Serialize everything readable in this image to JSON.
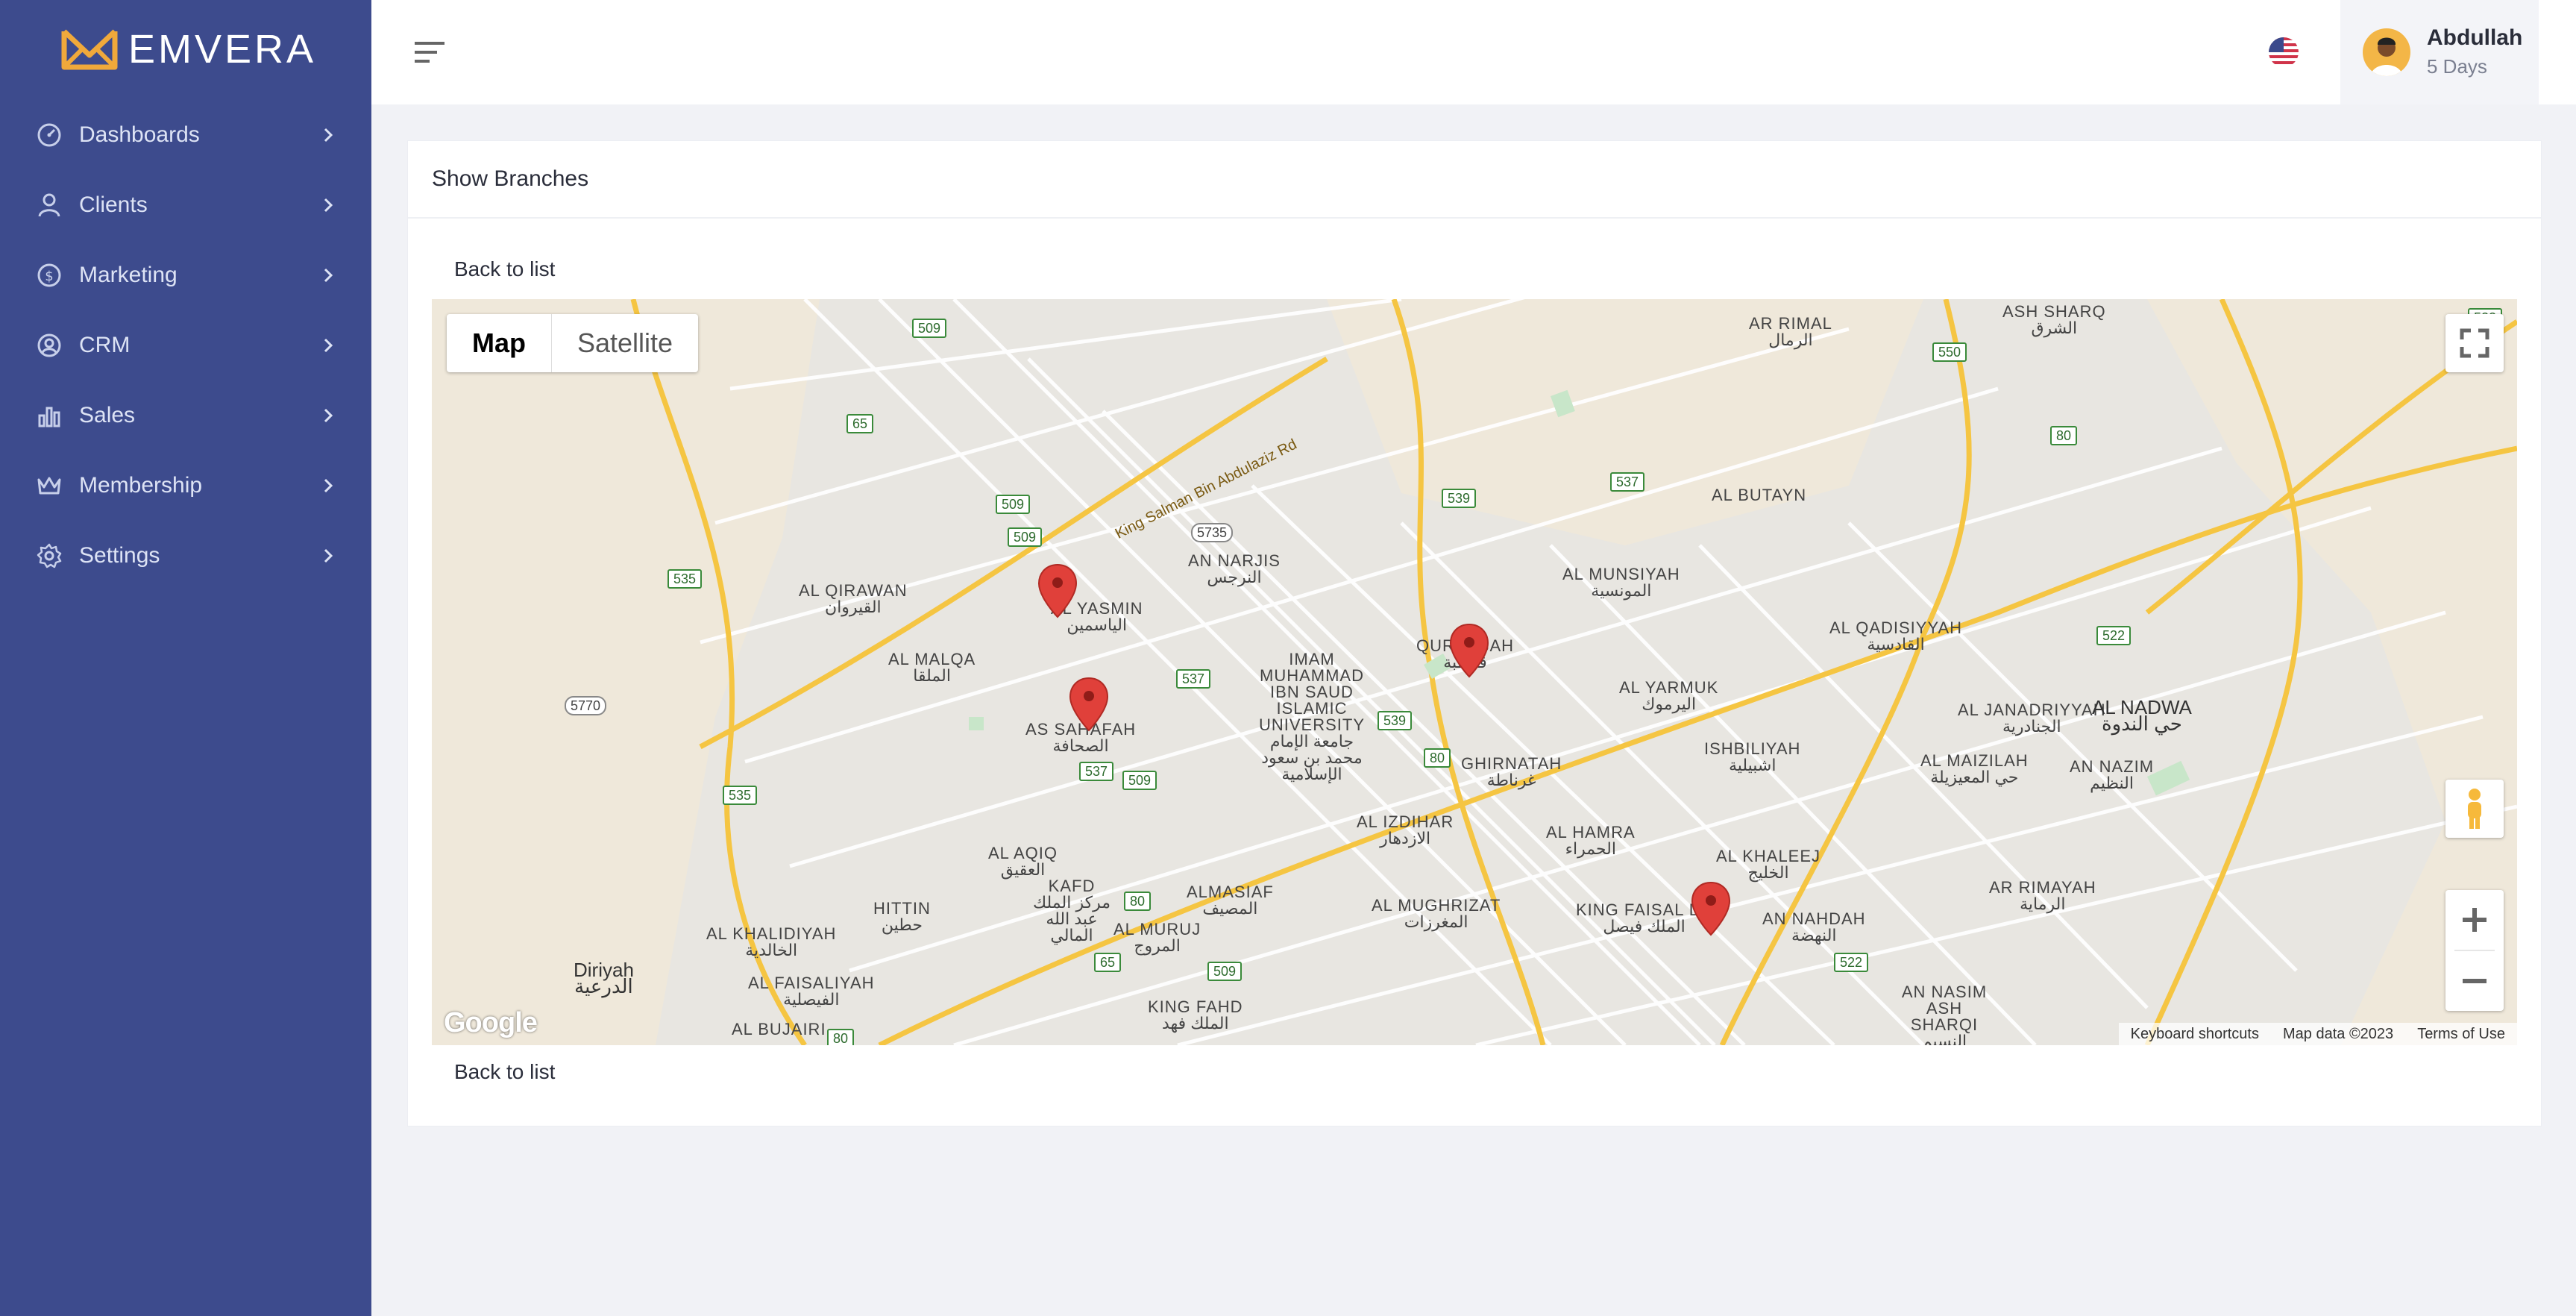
{
  "brand": {
    "name": "EMVERA",
    "accent": "#f0a93b",
    "sidebar_bg": "#3d4b8d"
  },
  "sidebar": {
    "items": [
      {
        "label": "Dashboards",
        "icon": "gauge-icon"
      },
      {
        "label": "Clients",
        "icon": "user-icon"
      },
      {
        "label": "Marketing",
        "icon": "dollar-circle-icon"
      },
      {
        "label": "CRM",
        "icon": "user-circle-icon"
      },
      {
        "label": "Sales",
        "icon": "bar-chart-icon"
      },
      {
        "label": "Membership",
        "icon": "crown-icon"
      },
      {
        "label": "Settings",
        "icon": "gear-icon"
      }
    ]
  },
  "topbar": {
    "flag": "us-flag-icon",
    "user": {
      "name": "Abdullah",
      "subtitle": "5 Days"
    }
  },
  "card": {
    "title": "Show Branches",
    "back_label": "Back to list"
  },
  "map": {
    "toggle": {
      "map_label": "Map",
      "satellite_label": "Satellite",
      "selected": "Map"
    },
    "footer": {
      "shortcuts": "Keyboard shortcuts",
      "data": "Map data ©2023",
      "terms": "Terms of Use"
    },
    "logo": "Google",
    "road_label": "King Salman Bin Abdulaziz Rd",
    "labels": [
      {
        "en": "AL QIRAWAN",
        "ar": "القيروان"
      },
      {
        "en": "AL YASMIN",
        "ar": "الياسمين"
      },
      {
        "en": "AN NARJIS",
        "ar": "النرجس"
      },
      {
        "en": "AL MALQA",
        "ar": "الملقا"
      },
      {
        "en": "IMAM MUHAMMAD IBN SAUD ISLAMIC UNIVERSITY",
        "ar": "جامعة الإمام محمد بن سعود الإسلامية"
      },
      {
        "en": "AS SAHAFAH",
        "ar": "الصحافة"
      },
      {
        "en": "QURTUBAH",
        "ar": "قرطبة"
      },
      {
        "en": "AL MUNSIYAH",
        "ar": "المونسية"
      },
      {
        "en": "AL BUTAYN",
        "ar": ""
      },
      {
        "en": "AR RIMAL",
        "ar": "الرمال"
      },
      {
        "en": "ASH SHARQ",
        "ar": "الشرق"
      },
      {
        "en": "AL QADISIYYAH",
        "ar": "القادسية"
      },
      {
        "en": "AL YARMUK",
        "ar": "اليرموك"
      },
      {
        "en": "GHIRNATAH",
        "ar": "غرناطة"
      },
      {
        "en": "ISHBILIYAH",
        "ar": "اشبيلية"
      },
      {
        "en": "AL JANADRIYYAH",
        "ar": "الجنادرية"
      },
      {
        "en": "AL NADWA",
        "ar": "حي الندوة"
      },
      {
        "en": "AL MAIZILAH",
        "ar": "حي المعيزيلة"
      },
      {
        "en": "AN NAZIM",
        "ar": "النظيم"
      },
      {
        "en": "AL IZDIHAR",
        "ar": "الازدهار"
      },
      {
        "en": "AL HAMRA",
        "ar": "الحمراء"
      },
      {
        "en": "AL KHALEEJ",
        "ar": "الخليج"
      },
      {
        "en": "AL AQIQ",
        "ar": "العقيق"
      },
      {
        "en": "KAFD",
        "ar": "مركز الملك عبد الله المالي"
      },
      {
        "en": "ALMASIAF",
        "ar": "المصيف"
      },
      {
        "en": "AL MUGHRIZAT",
        "ar": "المغرزات"
      },
      {
        "en": "KING FAISAL DT",
        "ar": "الملك فيصل"
      },
      {
        "en": "AN NAHDAH",
        "ar": "النهضة"
      },
      {
        "en": "AR RIMAYAH",
        "ar": "الرماية"
      },
      {
        "en": "HITTIN",
        "ar": "حطين"
      },
      {
        "en": "AL MURUJ",
        "ar": "المروج"
      },
      {
        "en": "AL KHALIDIYAH",
        "ar": "الخالدية"
      },
      {
        "en": "AL FAISALIYAH",
        "ar": "الفيصلية"
      },
      {
        "en": "KING FAHD",
        "ar": "الملك فهد"
      },
      {
        "en": "AN NASIM ASH SHARQI",
        "ar": "النسيم الشرقي"
      },
      {
        "en": "AL BUJAIRI",
        "ar": ""
      },
      {
        "en": "Diriyah",
        "ar": "الدرعية"
      }
    ],
    "shields": [
      "509",
      "65",
      "509",
      "509",
      "535",
      "5735",
      "537",
      "539",
      "537",
      "550",
      "80",
      "522",
      "522",
      "80",
      "535",
      "5770",
      "537",
      "509",
      "539",
      "80",
      "65",
      "509",
      "80",
      "522",
      "522",
      "80"
    ]
  }
}
